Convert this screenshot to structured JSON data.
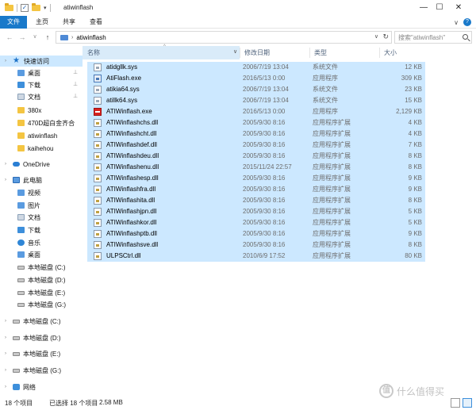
{
  "window": {
    "title": "atiwinflash",
    "buttons": [
      "—",
      "☐",
      "✕"
    ]
  },
  "quick_access_toolbar": {
    "check": "✓",
    "dropdown": "▾"
  },
  "ribbon": {
    "tabs": [
      "文件",
      "主页",
      "共享",
      "查看"
    ],
    "expand": "∨",
    "help": "?"
  },
  "address": {
    "path_sep": "›",
    "path": "atiwinflash",
    "dropdown": "∨",
    "refresh": "↻",
    "nav_back": "←",
    "nav_forward": "→",
    "nav_recent": "∨",
    "nav_up": "↑"
  },
  "search": {
    "placeholder": "搜索\"atiwinflash\""
  },
  "nav_pane": {
    "quick_access": "快速访问",
    "quick_items": [
      {
        "label": "桌面",
        "pinned": true
      },
      {
        "label": "下载",
        "pinned": true
      },
      {
        "label": "文档",
        "pinned": true
      },
      {
        "label": "380x"
      },
      {
        "label": "470D超白金齐合"
      },
      {
        "label": "atiwinflash"
      },
      {
        "label": "kaihehou"
      }
    ],
    "onedrive": "OneDrive",
    "this_pc": "此电脑",
    "pc_items": [
      "视频",
      "图片",
      "文档",
      "下载",
      "音乐",
      "桌面"
    ],
    "pc_drives": [
      "本地磁盘 (C:)",
      "本地磁盘 (D:)",
      "本地磁盘 (E:)",
      "本地磁盘 (G:)"
    ],
    "drives": [
      "本地磁盘 (C:)",
      "本地磁盘 (D:)",
      "本地磁盘 (E:)",
      "本地磁盘 (G:)"
    ],
    "network": "网络",
    "pin_glyph": "📌",
    "chevron": "›"
  },
  "columns": {
    "name": "名称",
    "date": "修改日期",
    "type": "类型",
    "size": "大小",
    "sort_glyph": "^",
    "name_dropdown": "∨"
  },
  "files": [
    {
      "name": "atidgllk.sys",
      "date": "2006/7/19 13:04",
      "type": "系统文件",
      "size": "12 KB",
      "kind": "sys"
    },
    {
      "name": "AtiFlash.exe",
      "date": "2016/5/13 0:00",
      "type": "应用程序",
      "size": "309 KB",
      "kind": "exe"
    },
    {
      "name": "atikia64.sys",
      "date": "2006/7/19 13:04",
      "type": "系统文件",
      "size": "23 KB",
      "kind": "sys"
    },
    {
      "name": "atillk64.sys",
      "date": "2006/7/19 13:04",
      "type": "系统文件",
      "size": "15 KB",
      "kind": "sys"
    },
    {
      "name": "ATIWinflash.exe",
      "date": "2016/5/13 0:00",
      "type": "应用程序",
      "size": "2,129 KB",
      "kind": "ati"
    },
    {
      "name": "ATIWinflashchs.dll",
      "date": "2005/9/30 8:16",
      "type": "应用程序扩展",
      "size": "4 KB",
      "kind": "dll"
    },
    {
      "name": "ATIWinflashcht.dll",
      "date": "2005/9/30 8:16",
      "type": "应用程序扩展",
      "size": "4 KB",
      "kind": "dll"
    },
    {
      "name": "ATIWinflashdef.dll",
      "date": "2005/9/30 8:16",
      "type": "应用程序扩展",
      "size": "7 KB",
      "kind": "dll"
    },
    {
      "name": "ATIWinflashdeu.dll",
      "date": "2005/9/30 8:16",
      "type": "应用程序扩展",
      "size": "8 KB",
      "kind": "dll"
    },
    {
      "name": "ATIWinflashenu.dll",
      "date": "2015/11/24 22:57",
      "type": "应用程序扩展",
      "size": "8 KB",
      "kind": "dll"
    },
    {
      "name": "ATIWinflashesp.dll",
      "date": "2005/9/30 8:16",
      "type": "应用程序扩展",
      "size": "9 KB",
      "kind": "dll"
    },
    {
      "name": "ATIWinflashfra.dll",
      "date": "2005/9/30 8:16",
      "type": "应用程序扩展",
      "size": "9 KB",
      "kind": "dll"
    },
    {
      "name": "ATIWinflashita.dll",
      "date": "2005/9/30 8:16",
      "type": "应用程序扩展",
      "size": "8 KB",
      "kind": "dll"
    },
    {
      "name": "ATIWinflashjpn.dll",
      "date": "2005/9/30 8:16",
      "type": "应用程序扩展",
      "size": "5 KB",
      "kind": "dll"
    },
    {
      "name": "ATIWinflashkor.dll",
      "date": "2005/9/30 8:16",
      "type": "应用程序扩展",
      "size": "5 KB",
      "kind": "dll"
    },
    {
      "name": "ATIWinflashptb.dll",
      "date": "2005/9/30 8:16",
      "type": "应用程序扩展",
      "size": "9 KB",
      "kind": "dll"
    },
    {
      "name": "ATIWinflashsve.dll",
      "date": "2005/9/30 8:16",
      "type": "应用程序扩展",
      "size": "8 KB",
      "kind": "dll"
    },
    {
      "name": "ULPSCtrl.dll",
      "date": "2010/6/9 17:52",
      "type": "应用程序扩展",
      "size": "80 KB",
      "kind": "dll"
    }
  ],
  "status": {
    "count": "18 个项目",
    "selected": "已选择 18 个项目",
    "size": "2.58 MB"
  },
  "watermark": {
    "logo": "值",
    "text": "什么值得买"
  },
  "colors": {
    "accent": "#1979ca",
    "selection": "#cce8ff",
    "header_sorted": "#d9ebf9"
  }
}
